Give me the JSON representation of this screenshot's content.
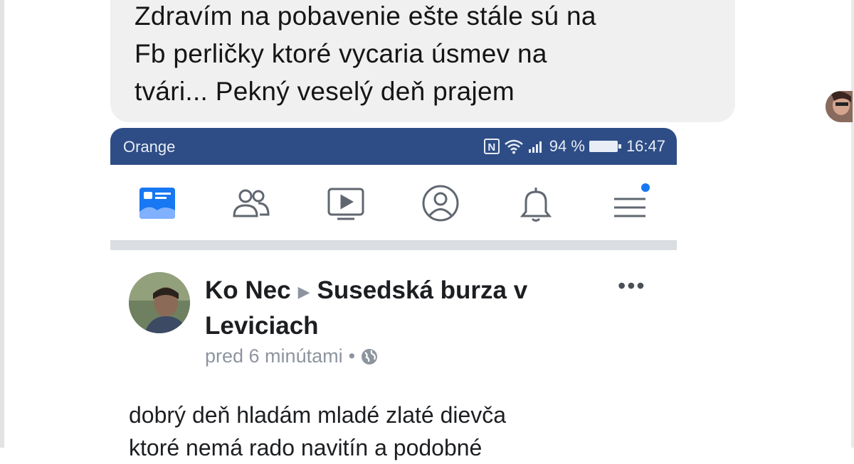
{
  "message": {
    "text": "Zdravím na pobavenie ešte stále sú na\nFb perličky ktoré vycaria úsmev na\ntvári... Pekný veselý deň prajem"
  },
  "status_bar": {
    "carrier": "Orange",
    "nfc": "N",
    "battery": "94 %",
    "time": "16:47"
  },
  "nav": {
    "icons": [
      "news-feed-icon",
      "friends-icon",
      "watch-icon",
      "profile-icon",
      "bell-icon",
      "menu-icon"
    ],
    "accent": "#1877f2"
  },
  "post": {
    "author": "Ko Nec",
    "group": "Susedská burza v Leviciach",
    "time": "pred 6 minútami",
    "separator": "•",
    "body": "dobrý deň hladám mladé zlaté dievča\nktoré nemá rado navitín a podobné"
  },
  "colors": {
    "status_bar": "#2e4d86",
    "bubble": "#f0f0f1"
  }
}
